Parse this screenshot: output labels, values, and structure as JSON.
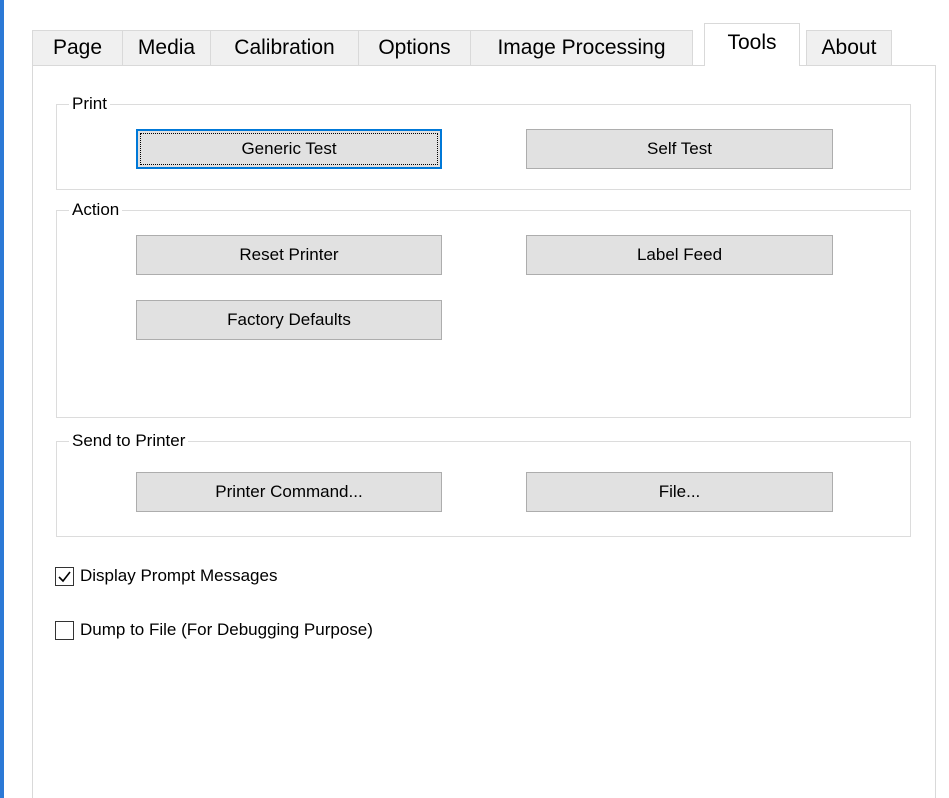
{
  "tabs": [
    {
      "label": "Page",
      "active": false
    },
    {
      "label": "Media",
      "active": false
    },
    {
      "label": "Calibration",
      "active": false
    },
    {
      "label": "Options",
      "active": false
    },
    {
      "label": "Image Processing",
      "active": false
    },
    {
      "label": "Tools",
      "active": true
    },
    {
      "label": "About",
      "active": false
    }
  ],
  "print_group": {
    "title": "Print",
    "generic_test": "Generic Test",
    "self_test": "Self Test"
  },
  "action_group": {
    "title": "Action",
    "reset_printer": "Reset Printer",
    "label_feed": "Label Feed",
    "factory_defaults": "Factory Defaults"
  },
  "send_group": {
    "title": "Send to Printer",
    "printer_command": "Printer Command...",
    "file": "File..."
  },
  "options": {
    "display_prompt": {
      "label": "Display Prompt Messages",
      "checked": true
    },
    "dump_to_file": {
      "label": "Dump to File (For Debugging Purpose)",
      "checked": false
    }
  },
  "colors": {
    "accent": "#0078d7",
    "window_edge": "#2b79d6",
    "button_face": "#e1e1e1"
  }
}
